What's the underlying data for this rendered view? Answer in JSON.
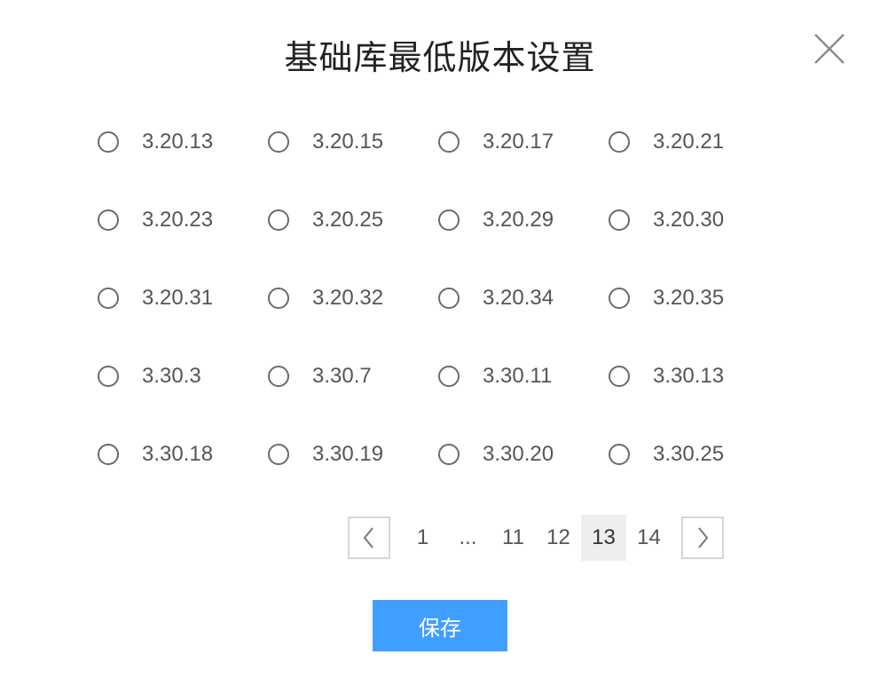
{
  "dialog": {
    "title": "基础库最低版本设置",
    "save_label": "保存"
  },
  "options": [
    [
      "3.20.13",
      "3.20.15",
      "3.20.17",
      "3.20.21"
    ],
    [
      "3.20.23",
      "3.20.25",
      "3.20.29",
      "3.20.30"
    ],
    [
      "3.20.31",
      "3.20.32",
      "3.20.34",
      "3.20.35"
    ],
    [
      "3.30.3",
      "3.30.7",
      "3.30.11",
      "3.30.13"
    ],
    [
      "3.30.18",
      "3.30.19",
      "3.30.20",
      "3.30.25"
    ]
  ],
  "pagination": {
    "pages": [
      "1",
      "...",
      "11",
      "12",
      "13",
      "14"
    ],
    "current": "13"
  },
  "colors": {
    "primary": "#409eff",
    "current_page_bg": "#eeeeee",
    "border": "#d6d6d6"
  },
  "icons": {
    "close": "close-icon",
    "prev": "chevron-left-icon",
    "next": "chevron-right-icon"
  }
}
